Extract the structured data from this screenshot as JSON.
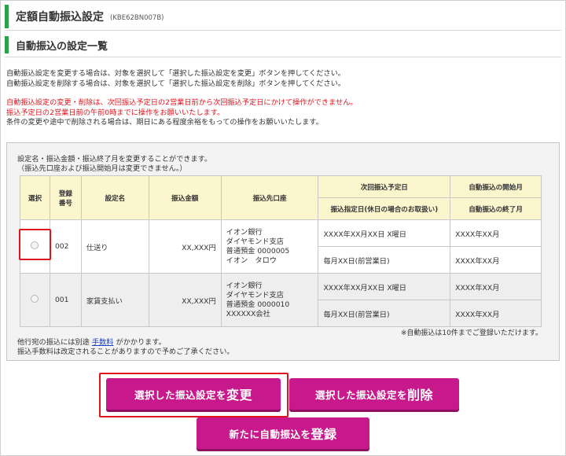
{
  "page": {
    "title": "定額自動振込設定",
    "code": "(KBE62BN007B)",
    "section_title": "自動振込の設定一覧"
  },
  "notes": {
    "line1": "自動振込設定を変更する場合は、対象を選択して「選択した振込設定を変更」ボタンを押してください。",
    "line2": "自動振込設定を削除する場合は、対象を選択して「選択した振込設定を削除」ボタンを押してください。",
    "red1": "自動振込設定の変更・削除は、次回振込予定日の2営業日前から次回振込予定日にかけて操作ができません。",
    "red2": "振込予定日の2営業日前の午前0時までに操作をお願いいたします。",
    "line3": "条件の変更や途中で削除される場合は、期日にある程度余裕をもっての操作をお願いいたします。"
  },
  "panel": {
    "hint1": "設定名・振込金額・振込終了月を変更することができます。",
    "hint2": "（振込先口座および振込開始月は変更できません。）"
  },
  "table": {
    "headers": {
      "select": "選択",
      "reg_no_1": "登録",
      "reg_no_2": "番号",
      "name": "設定名",
      "amount": "振込金額",
      "dest": "振込先口座",
      "next_date": "次回振込予定日",
      "designated": "振込指定日(休日の場合のお取扱い)",
      "start_month": "自動振込の開始月",
      "end_month": "自動振込の終了月"
    },
    "rows": [
      {
        "reg_no": "002",
        "name": "仕送り",
        "amount": "XX,XXX円",
        "dest1": "イオン銀行",
        "dest2": "ダイヤモンド支店",
        "dest3": "普通預金 0000005",
        "dest4": "イオン　タロウ",
        "next_date": "XXXX年XX月XX日 X曜日",
        "designated": "毎月XX日(前営業日)",
        "start_month": "XXXX年XX月",
        "end_month": "XXXX年XX月"
      },
      {
        "reg_no": "001",
        "name": "家賃支払い",
        "amount": "XX,XXX円",
        "dest1": "イオン銀行",
        "dest2": "ダイヤモンド支店",
        "dest3": "普通預金 0000010",
        "dest4": "XXXXXX会社",
        "next_date": "XXXX年XX月XX日 X曜日",
        "designated": "毎月XX日(前営業日)",
        "start_month": "XXXX年XX月",
        "end_month": "XXXX年XX月"
      }
    ]
  },
  "footer": {
    "limit_note": "※自動振込は10件までご登録いただけます。",
    "fee_pre": "他行宛の振込には別途",
    "fee_link": "手数料",
    "fee_post": "がかかります。",
    "fee_note": "振込手数料は改定されることがありますので予めご了承ください。"
  },
  "buttons": {
    "edit_a": "選択した振込設定を",
    "edit_b": "変更",
    "delete_a": "選択した振込設定を",
    "delete_b": "削除",
    "new_a": "新たに自動振込を",
    "new_b": "登録"
  },
  "colors": {
    "accent_green": "#2aa24a",
    "button_magenta": "#c8198c",
    "warning_red": "#e0141e",
    "header_yellow": "#fcf6cf"
  }
}
